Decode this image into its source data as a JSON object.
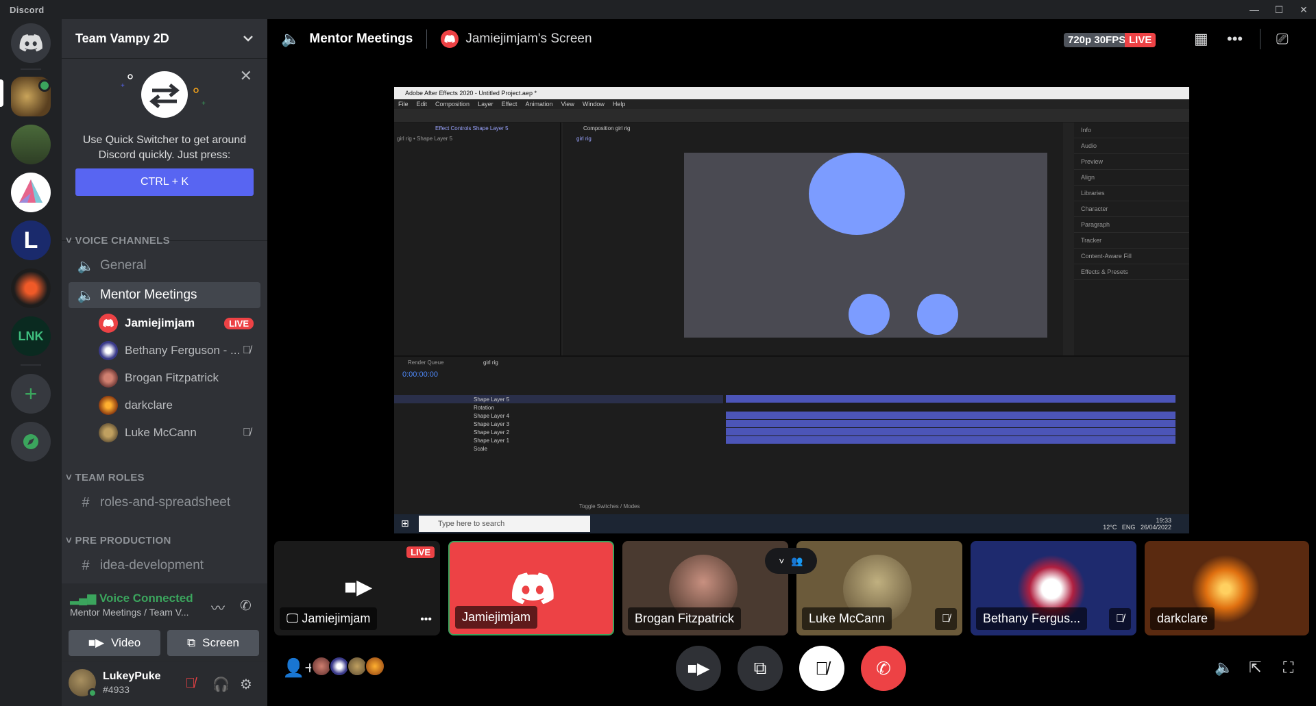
{
  "titlebar": {
    "app_name": "Discord",
    "minimize": "—",
    "maximize": "☐",
    "close": "✕"
  },
  "server": {
    "name": "Team Vampy 2D"
  },
  "quick_switcher": {
    "text": "Use Quick Switcher to get around Discord quickly. Just press:",
    "shortcut": "CTRL + K"
  },
  "categories": {
    "voice": "VOICE CHANNELS",
    "roles": "TEAM ROLES",
    "pre": "PRE PRODUCTION"
  },
  "channels": {
    "general": "General",
    "mentor": "Mentor Meetings",
    "roles": "roles-and-spreadsheet",
    "idea": "idea-development"
  },
  "voice_users": [
    {
      "name": "Jamiejimjam",
      "live": "LIVE"
    },
    {
      "name": "Bethany Ferguson - ..."
    },
    {
      "name": "Brogan Fitzpatrick"
    },
    {
      "name": "darkclare"
    },
    {
      "name": "Luke McCann"
    }
  ],
  "voice_panel": {
    "status": "Voice Connected",
    "location": "Mentor Meetings / Team V...",
    "video_label": "Video",
    "screen_label": "Screen"
  },
  "user": {
    "name": "LukeyPuke",
    "tag": "#4933"
  },
  "stage": {
    "channel": "Mentor Meetings",
    "screen_title": "Jamiejimjam's Screen",
    "quality": "720p 30FPS",
    "live": "LIVE"
  },
  "ae": {
    "title": "Adobe After Effects 2020 - Untitled Project.aep *",
    "menu": [
      "File",
      "Edit",
      "Composition",
      "Layer",
      "Effect",
      "Animation",
      "View",
      "Window",
      "Help"
    ],
    "effect_controls": "Effect Controls Shape Layer 5",
    "breadcrumb": "girl rig • Shape Layer 5",
    "composition": "Composition girl rig",
    "comp_tab": "girl rig",
    "right_panels": [
      "Info",
      "Audio",
      "Preview",
      "Align",
      "Libraries",
      "Character",
      "Paragraph",
      "Tracker",
      "Content-Aware Fill",
      "Effects & Presets"
    ],
    "timecode": "0:00:00:00",
    "render_queue": "Render Queue",
    "timeline_tab": "girl rig",
    "layers": [
      "Shape Layer 5",
      "Rotation",
      "Shape Layer 4",
      "Shape Layer 3",
      "Shape Layer 2",
      "Shape Layer 1",
      "Scale"
    ],
    "toggle": "Toggle Switches / Modes",
    "search_placeholder": "Type here to search",
    "temp": "12°C",
    "lang": "ENG",
    "time": "19:33",
    "date": "26/04/2022"
  },
  "tiles": [
    {
      "name": "Jamiejimjam",
      "live": "LIVE"
    },
    {
      "name": "Jamiejimjam"
    },
    {
      "name": "Brogan Fitzpatrick"
    },
    {
      "name": "Luke McCann"
    },
    {
      "name": "Bethany Fergus..."
    },
    {
      "name": "darkclare"
    }
  ],
  "colors": {
    "blurple": "#5865f2",
    "green": "#3ba55d",
    "red": "#ed4245"
  }
}
